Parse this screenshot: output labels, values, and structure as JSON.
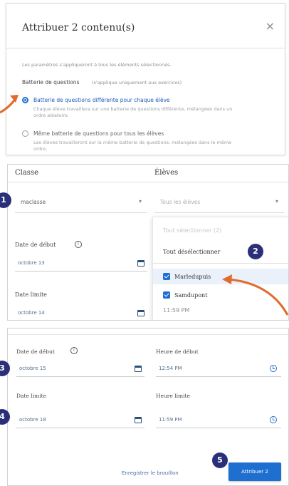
{
  "modal": {
    "title": "Attribuer 2 contenu(s)",
    "close": "×",
    "intro": "Les paramètres s'appliqueront à tous les éléments sélectionnés.",
    "section_label": "Batterie de questions",
    "section_note": "(s'applique uniquement aux exercices)",
    "option1_label": "Batterie de questions différente pour chaque élève",
    "option1_desc": "Chaque élève travaillera sur une batterie de questions différente, mélangées dans un ordre aléatoire.",
    "option2_label": "Même batterie de questions pour tous les élèves",
    "option2_desc": "Les élèves travailleront sur la même batterie de questions, mélangées dans le même ordre."
  },
  "assign": {
    "class_header": "Classe",
    "students_header": "Élèves",
    "class_value": "maclasse",
    "students_value": "Tous les élèves",
    "start_label": "Date de début",
    "start_date": "octobre 13",
    "due_label": "Date limite",
    "due_date": "octobre 14",
    "dropdown": {
      "select_all": "Tout sélectionner (2)",
      "deselect_all": "Tout désélectionner",
      "students": [
        "Marledupuis",
        "Samdupont"
      ],
      "time_peek": "11:59 PM"
    }
  },
  "schedule": {
    "start_date_label": "Date de début",
    "start_date": "octobre 15",
    "start_time_label": "Heure de début",
    "start_time": "12:54 PM",
    "due_date_label": "Date limite",
    "due_date": "octobre 18",
    "due_time_label": "Heure limite",
    "due_time": "11:59 PM",
    "save_draft": "Enregistrer le brouillon",
    "assign_button": "Attribuer 2"
  },
  "badges": [
    "1",
    "2",
    "3",
    "4",
    "5"
  ],
  "colors": {
    "primary": "#1f6fd1",
    "badge": "#2b2f79",
    "arrow": "#e06b2d"
  }
}
